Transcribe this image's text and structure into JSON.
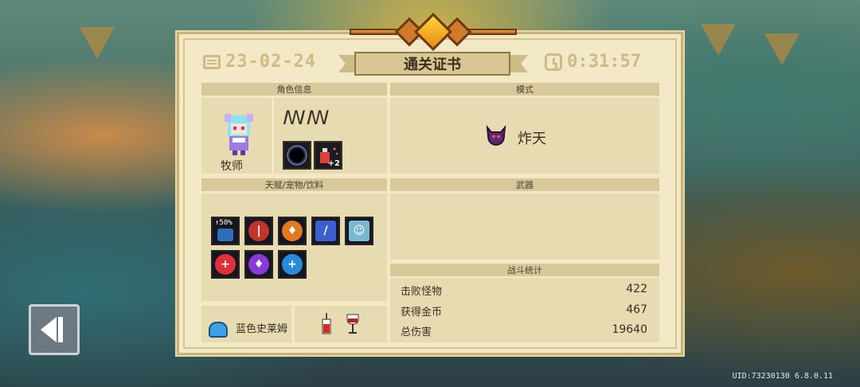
{
  "certificate": {
    "title": "通关证书",
    "date": "23-02-24",
    "time": "0:31:57"
  },
  "sections": {
    "character_info": "角色信息",
    "mode": "模式",
    "talent_pet_drink": "天赋/宠物/饮料",
    "weapon": "武器",
    "battle_stats": "战斗统计"
  },
  "character": {
    "class_name": "牧师",
    "player_name": "ꟿꟿ",
    "skill_icons": [
      "black-hole-icon",
      "potion-plus-icon"
    ],
    "skill_badge": "+2"
  },
  "mode": {
    "icon": "horned-demon-icon",
    "name": "炸天"
  },
  "buffs": [
    {
      "icon": "shield-up-50-icon",
      "label": "↑50%"
    },
    {
      "icon": "sword-icon"
    },
    {
      "icon": "fire-shield-icon"
    },
    {
      "icon": "staff-icon"
    },
    {
      "icon": "meditate-icon"
    },
    {
      "icon": "health-cross-icon"
    },
    {
      "icon": "purple-shield-icon"
    },
    {
      "icon": "blue-cross-shield-icon"
    }
  ],
  "pet": {
    "icon": "blue-slime-icon",
    "name": "蓝色史莱姆"
  },
  "drinks": [
    "red-drink-icon",
    "wine-glass-icon"
  ],
  "stats": [
    {
      "label": "击败怪物",
      "value": "422"
    },
    {
      "label": "获得金币",
      "value": "467"
    },
    {
      "label": "总伤害",
      "value": "19640"
    }
  ],
  "footer": {
    "uid": "UID:73230130 6.8.0.11"
  },
  "colors": {
    "paper": "#f3e9c6",
    "panel": "#e7dbb2",
    "header": "#d8c99a",
    "gem": "#ffd33a"
  }
}
